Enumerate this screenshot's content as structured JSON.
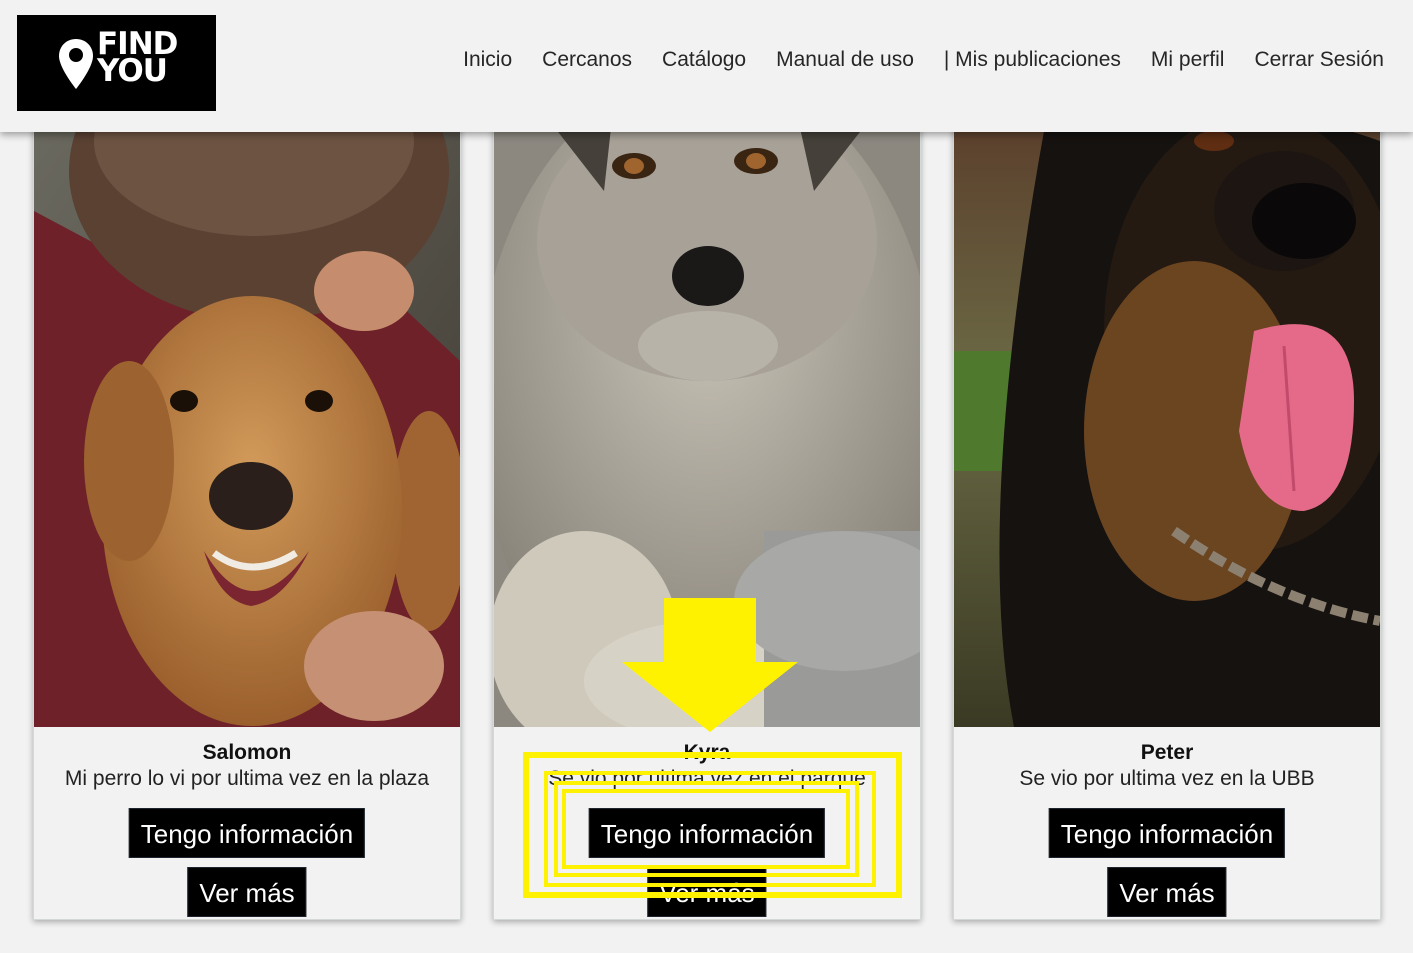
{
  "app": {
    "logo_text": [
      "FIND",
      "YOU"
    ]
  },
  "nav": {
    "items": [
      {
        "id": "inicio",
        "label": "Inicio"
      },
      {
        "id": "cercanos",
        "label": "Cercanos"
      },
      {
        "id": "catalogo",
        "label": "Catálogo"
      },
      {
        "id": "manual",
        "label": "Manual de uso"
      },
      {
        "id": "publicaciones",
        "label": "| Mis publicaciones"
      },
      {
        "id": "perfil",
        "label": "Mi perfil"
      },
      {
        "id": "cerrar",
        "label": "Cerrar Sesión"
      }
    ]
  },
  "cards": [
    {
      "name": "Salomon",
      "description": "Mi perro lo vi por ultima vez en la plaza",
      "info_button": "Tengo información",
      "more_button": "Ver más",
      "photo": "golden-retriever-hugged"
    },
    {
      "name": "Kyra",
      "description": "Se vio por ultima vez en el parque",
      "info_button": "Tengo información",
      "more_button": "Ver más",
      "photo": "grey-terrier-mix"
    },
    {
      "name": "Peter",
      "description": "Se vio por ultima vez en la UBB",
      "info_button": "Tengo información",
      "more_button": "Ver más",
      "photo": "black-tan-shepherd"
    }
  ],
  "colors": {
    "header_bg": "#f2f2f2",
    "button_bg": "#000000",
    "annotation": "#ffee00"
  }
}
